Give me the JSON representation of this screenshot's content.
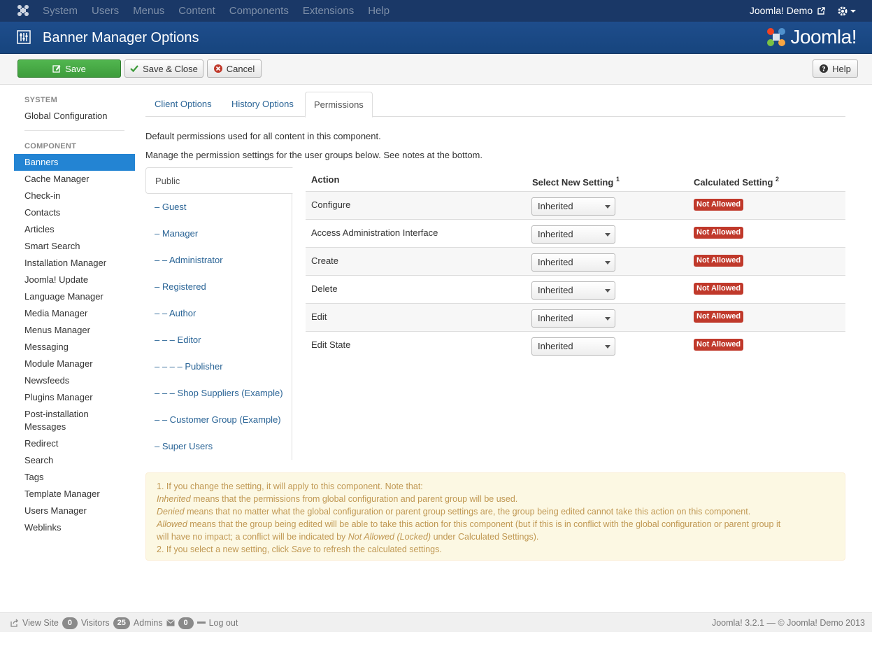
{
  "topnav": {
    "menu": [
      "System",
      "Users",
      "Menus",
      "Content",
      "Components",
      "Extensions",
      "Help"
    ],
    "user": "Joomla! Demo"
  },
  "header": {
    "title": "Banner Manager Options",
    "brand": "Joomla!"
  },
  "toolbar": {
    "save": "Save",
    "save_close": "Save & Close",
    "cancel": "Cancel",
    "help": "Help"
  },
  "sidebar": {
    "system_heading": "SYSTEM",
    "global_config": "Global Configuration",
    "component_heading": "COMPONENT",
    "items": [
      "Banners",
      "Cache Manager",
      "Check-in",
      "Contacts",
      "Articles",
      "Smart Search",
      "Installation Manager",
      "Joomla! Update",
      "Language Manager",
      "Media Manager",
      "Menus Manager",
      "Messaging",
      "Module Manager",
      "Newsfeeds",
      "Plugins Manager",
      "Post-installation Messages",
      "Redirect",
      "Search",
      "Tags",
      "Template Manager",
      "Users Manager",
      "Weblinks"
    ]
  },
  "tabs": [
    "Client Options",
    "History Options",
    "Permissions"
  ],
  "intro": {
    "line1": "Default permissions used for all content in this component.",
    "line2": "Manage the permission settings for the user groups below. See notes at the bottom."
  },
  "groups": [
    "Public",
    "– Guest",
    "– Manager",
    "– – Administrator",
    "– Registered",
    "– – Author",
    "– – – Editor",
    "– – – – Publisher",
    "– – – Shop Suppliers (Example)",
    "– – Customer Group (Example)",
    "– Super Users"
  ],
  "permissions": {
    "headers": {
      "action": "Action",
      "select": "Select New Setting",
      "select_note": "1",
      "calc": "Calculated Setting",
      "calc_note": "2"
    },
    "rows": [
      {
        "action": "Configure",
        "setting": "Inherited",
        "calculated": "Not Allowed"
      },
      {
        "action": "Access Administration Interface",
        "setting": "Inherited",
        "calculated": "Not Allowed"
      },
      {
        "action": "Create",
        "setting": "Inherited",
        "calculated": "Not Allowed"
      },
      {
        "action": "Delete",
        "setting": "Inherited",
        "calculated": "Not Allowed"
      },
      {
        "action": "Edit",
        "setting": "Inherited",
        "calculated": "Not Allowed"
      },
      {
        "action": "Edit State",
        "setting": "Inherited",
        "calculated": "Not Allowed"
      }
    ]
  },
  "notes": {
    "n1": "1. If you change the setting, it will apply to this component. Note that:",
    "inherited_term": "Inherited",
    "inherited_text": " means that the permissions from global configuration and parent group will be used.",
    "denied_term": "Denied",
    "denied_text": " means that no matter what the global configuration or parent group settings are, the group being edited cannot take this action on this component.",
    "allowed_term": "Allowed",
    "allowed_text_a": " means that the group being edited will be able to take this action for this component (but if this is in conflict with the global configuration or parent group it",
    "allowed_text_b": "will have no impact; a conflict will be indicated by ",
    "locked_term": "Not Allowed (Locked)",
    "allowed_text_c": " under Calculated Settings).",
    "n2_a": "2. If you select a new setting, click ",
    "save_term": "Save",
    "n2_b": " to refresh the calculated settings."
  },
  "footer": {
    "view_site": "View Site",
    "visitors_count": "0",
    "visitors": "Visitors",
    "admins_count": "25",
    "admins": "Admins",
    "messages_count": "0",
    "logout": "Log out",
    "copyright": "Joomla! 3.2.1 — © Joomla! Demo 2013"
  },
  "colors": {
    "topbar": "#1a3867",
    "header": "#1e4d8c",
    "active": "#2384d3",
    "badge": "#c0392b",
    "save_button": "#46a546"
  }
}
